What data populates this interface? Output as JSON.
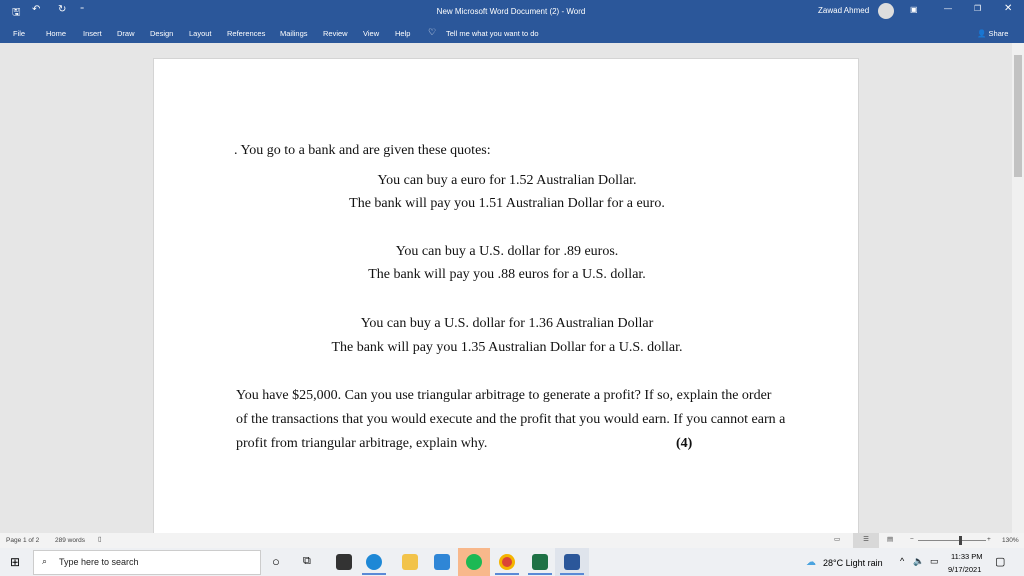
{
  "window": {
    "title": "New Microsoft Word Document (2)  -  Word",
    "user": "Zawad Ahmed"
  },
  "ribbon": {
    "tabs": [
      "File",
      "Home",
      "Insert",
      "Draw",
      "Design",
      "Layout",
      "References",
      "Mailings",
      "Review",
      "View",
      "Help"
    ],
    "tell_me": "Tell me what you want to do",
    "share": "Share"
  },
  "document": {
    "intro": ". You go to a bank and are given these quotes:",
    "quotes": [
      "You can buy a euro for 1.52 Australian Dollar.",
      "The bank will pay you 1.51 Australian Dollar for a euro.",
      "You can buy a U.S. dollar for .89 euros.",
      "The bank will pay you .88 euros for a U.S. dollar.",
      "You can buy a U.S. dollar for 1.36 Australian Dollar",
      "The bank will pay you 1.35 Australian Dollar for a U.S. dollar."
    ],
    "question_lines": [
      "You have $25,000. Can you use triangular arbitrage to generate a profit? If so, explain the order",
      "of the transactions that you would execute and the profit that you would earn. If you cannot earn a",
      "profit from triangular arbitrage, explain why."
    ],
    "marks": "(4)"
  },
  "status": {
    "page": "Page 1 of 2",
    "words": "289 words",
    "zoom": "130%",
    "zoom_fraction": 0.6
  },
  "taskbar": {
    "search_placeholder": "Type here to search",
    "weather": "28°C  Light rain",
    "time": "11:33 PM",
    "date": "9/17/2021"
  },
  "colors": {
    "word_blue": "#2b579a"
  }
}
